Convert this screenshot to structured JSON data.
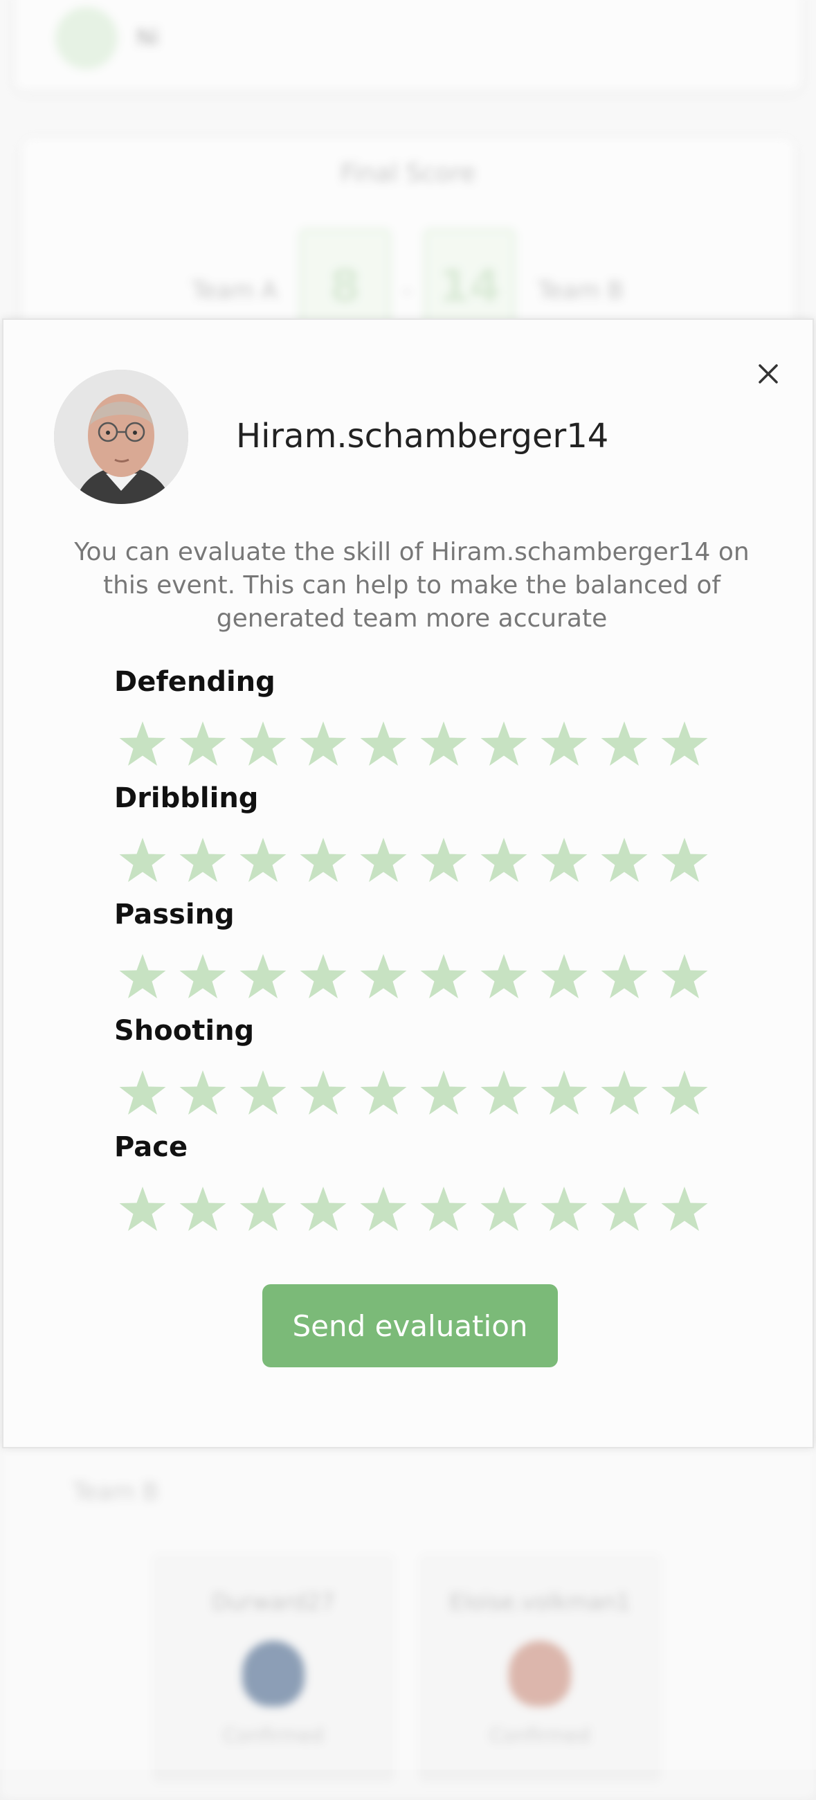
{
  "background": {
    "top_card": {
      "name": "Ni"
    },
    "score_card": {
      "title": "Final Score",
      "team_a": "Team A",
      "team_b": "Team B",
      "score_a": "8",
      "score_b": "14",
      "separator": "-"
    },
    "team_b_section": {
      "title": "Team B",
      "players": [
        {
          "name": "Durward27",
          "status": "Confirmed"
        },
        {
          "name": "Eloise.volkman1",
          "status": "Confirmed"
        }
      ]
    }
  },
  "modal": {
    "user_name": "Hiram.schamberger14",
    "description": "You can evaluate the skill of Hiram.schamberger14 on this event. This can help to make the balanced of generated team more accurate",
    "categories": [
      {
        "label": "Defending",
        "rating": 0,
        "max": 10
      },
      {
        "label": "Dribbling",
        "rating": 0,
        "max": 10
      },
      {
        "label": "Passing",
        "rating": 0,
        "max": 10
      },
      {
        "label": "Shooting",
        "rating": 0,
        "max": 10
      },
      {
        "label": "Pace",
        "rating": 0,
        "max": 10
      }
    ],
    "send_label": "Send evaluation",
    "close_icon": "close-icon"
  },
  "colors": {
    "accent": "#7bba78",
    "star_empty": "#c7e2c2",
    "text_muted": "#777777"
  }
}
